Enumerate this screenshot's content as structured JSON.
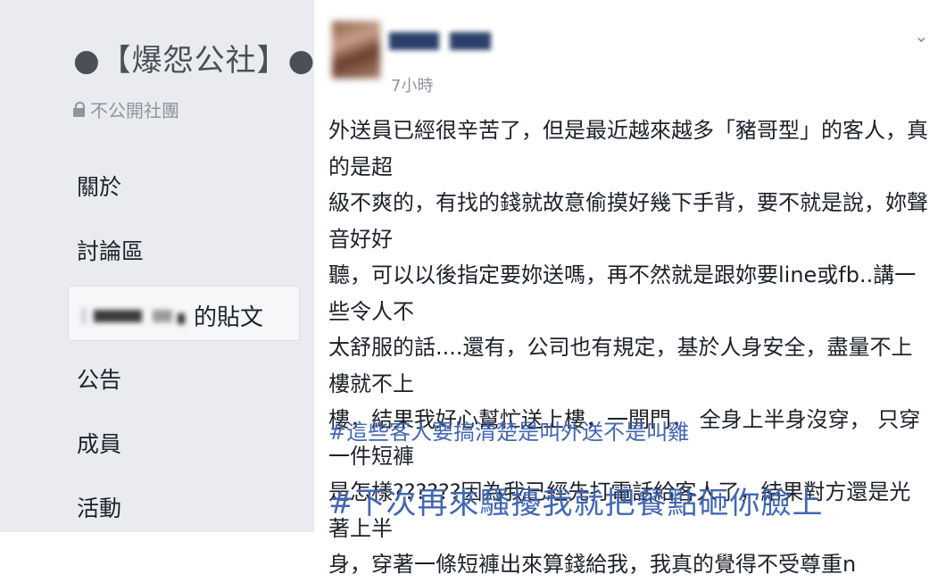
{
  "sidebar": {
    "group_name": "●【爆怨公社】●",
    "privacy": "不公開社團",
    "nav": {
      "about": "關於",
      "discussion": "討論區",
      "member_posts": "的貼文",
      "announcements": "公告",
      "members": "成員",
      "events": "活動"
    }
  },
  "post": {
    "timestamp": "7小時",
    "body": "外送員已經很辛苦了，但是最近越來越多「豬哥型」的客人，真的是超\n級不爽的，有找的錢就故意偷摸好幾下手背，要不就是說，妳聲音好好\n聽，可以以後指定要妳送嗎，再不然就是跟妳要line或fb..講一些令人不\n太舒服的話....還有，公司也有規定，基於人身安全，盡量不上樓就不上\n樓，結果我好心幫忙送上樓，一開門， 全身上半身沒穿， 只穿一件短褲\n是怎樣??????因為我已經先打電話給客人了，結果對方還是光著上半\n身，穿著一條短褲出來算錢給我，我真的覺得不受尊重n",
    "hashtag_1": "#這些客人要搞清楚是叫外送不是叫雞",
    "hashtag_2": "#下次再來騷擾我就把餐點砸你臉上"
  },
  "icons": {
    "lock": "lock-icon",
    "chevron": "chevron-down-icon"
  },
  "colors": {
    "sidebar_bg": "#e9ebee",
    "link": "#4267b2",
    "muted": "#90949c",
    "text": "#1d2129"
  }
}
